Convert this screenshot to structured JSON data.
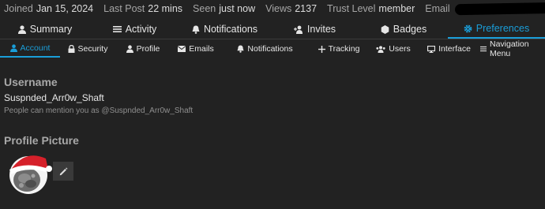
{
  "stats": {
    "joined_label": "Joined",
    "joined_value": "Jan 15, 2024",
    "last_post_label": "Last Post",
    "last_post_value": "22 mins",
    "seen_label": "Seen",
    "seen_value": "just now",
    "views_label": "Views",
    "views_value": "2137",
    "trust_label": "Trust Level",
    "trust_value": "member",
    "email_label": "Email"
  },
  "tabs": [
    {
      "label": "Summary",
      "icon": "user-icon"
    },
    {
      "label": "Activity",
      "icon": "list-icon"
    },
    {
      "label": "Notifications",
      "icon": "bell-icon"
    },
    {
      "label": "Invites",
      "icon": "user-plus-icon"
    },
    {
      "label": "Badges",
      "icon": "badge-icon"
    },
    {
      "label": "Preferences",
      "icon": "gear-icon",
      "active": true
    }
  ],
  "subtabs": [
    {
      "label": "Account",
      "icon": "user-icon",
      "active": true
    },
    {
      "label": "Security",
      "icon": "lock-icon"
    },
    {
      "label": "Profile",
      "icon": "user-icon"
    },
    {
      "label": "Emails",
      "icon": "envelope-icon"
    },
    {
      "label": "Notifications",
      "icon": "bell-icon"
    },
    {
      "label": "Tracking",
      "icon": "plus-icon"
    },
    {
      "label": "Users",
      "icon": "users-icon"
    },
    {
      "label": "Interface",
      "icon": "desktop-icon"
    },
    {
      "label": "Navigation Menu",
      "icon": "bars-icon"
    }
  ],
  "account": {
    "username_heading": "Username",
    "username": "Suspnded_Arr0w_Shaft",
    "mention_text": "People can mention you as @Suspnded_Arr0w_Shaft",
    "profile_picture_heading": "Profile Picture",
    "edit_icon": "pencil-icon"
  },
  "colors": {
    "background": "#222222",
    "accent": "#1a9ed9",
    "text": "#dddddd",
    "muted": "#a6a6a6",
    "button_bg": "#3a3a3a"
  }
}
